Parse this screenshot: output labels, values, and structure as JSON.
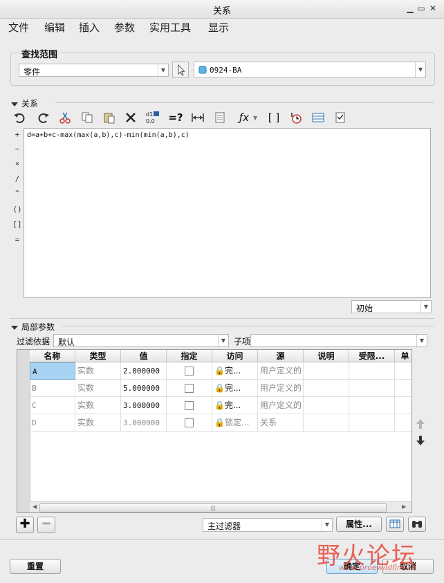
{
  "window": {
    "title": "关系"
  },
  "menu": [
    "文件",
    "编辑",
    "插入",
    "参数",
    "实用工具",
    "显示"
  ],
  "search_scope": {
    "title": "查找范围",
    "type_value": "零件",
    "model_value": "0924-BA"
  },
  "relations": {
    "section_label": "关系",
    "text": "d=a+b+c-max(max(a,b),c)-min(min(a,b),c)",
    "ops": [
      "+",
      "−",
      "×",
      "/",
      "^",
      "()",
      "[]",
      "="
    ],
    "state_value": "初始"
  },
  "local_params": {
    "section_label": "局部参数",
    "filter_label": "过滤依据",
    "filter_value": "默认",
    "subitem_label": "子项",
    "columns": [
      "名称",
      "类型",
      "值",
      "指定",
      "访问",
      "源",
      "说明",
      "受限...",
      "单"
    ],
    "rows": [
      {
        "name": "A",
        "type": "实数",
        "value": "2.000000",
        "access": "完...",
        "source": "用户定义的"
      },
      {
        "name": "B",
        "type": "实数",
        "value": "5.000000",
        "access": "完...",
        "source": "用户定义的"
      },
      {
        "name": "C",
        "type": "实数",
        "value": "3.000000",
        "access": "完...",
        "source": "用户定义的"
      },
      {
        "name": "D",
        "type": "实数",
        "value": "3.000000",
        "access": "锁定...",
        "source": "关系"
      }
    ],
    "main_filter_value": "主过滤器",
    "properties_label": "属性..."
  },
  "footer": {
    "reset_label": "重置",
    "ok_label": "确定",
    "cancel_label": "取消"
  },
  "watermark": {
    "text": "野火论坛",
    "url": "www.proewildfire.cn"
  },
  "colors": {
    "selected_cell": "#a9d3f2",
    "watermark_red": "#e8483b"
  }
}
